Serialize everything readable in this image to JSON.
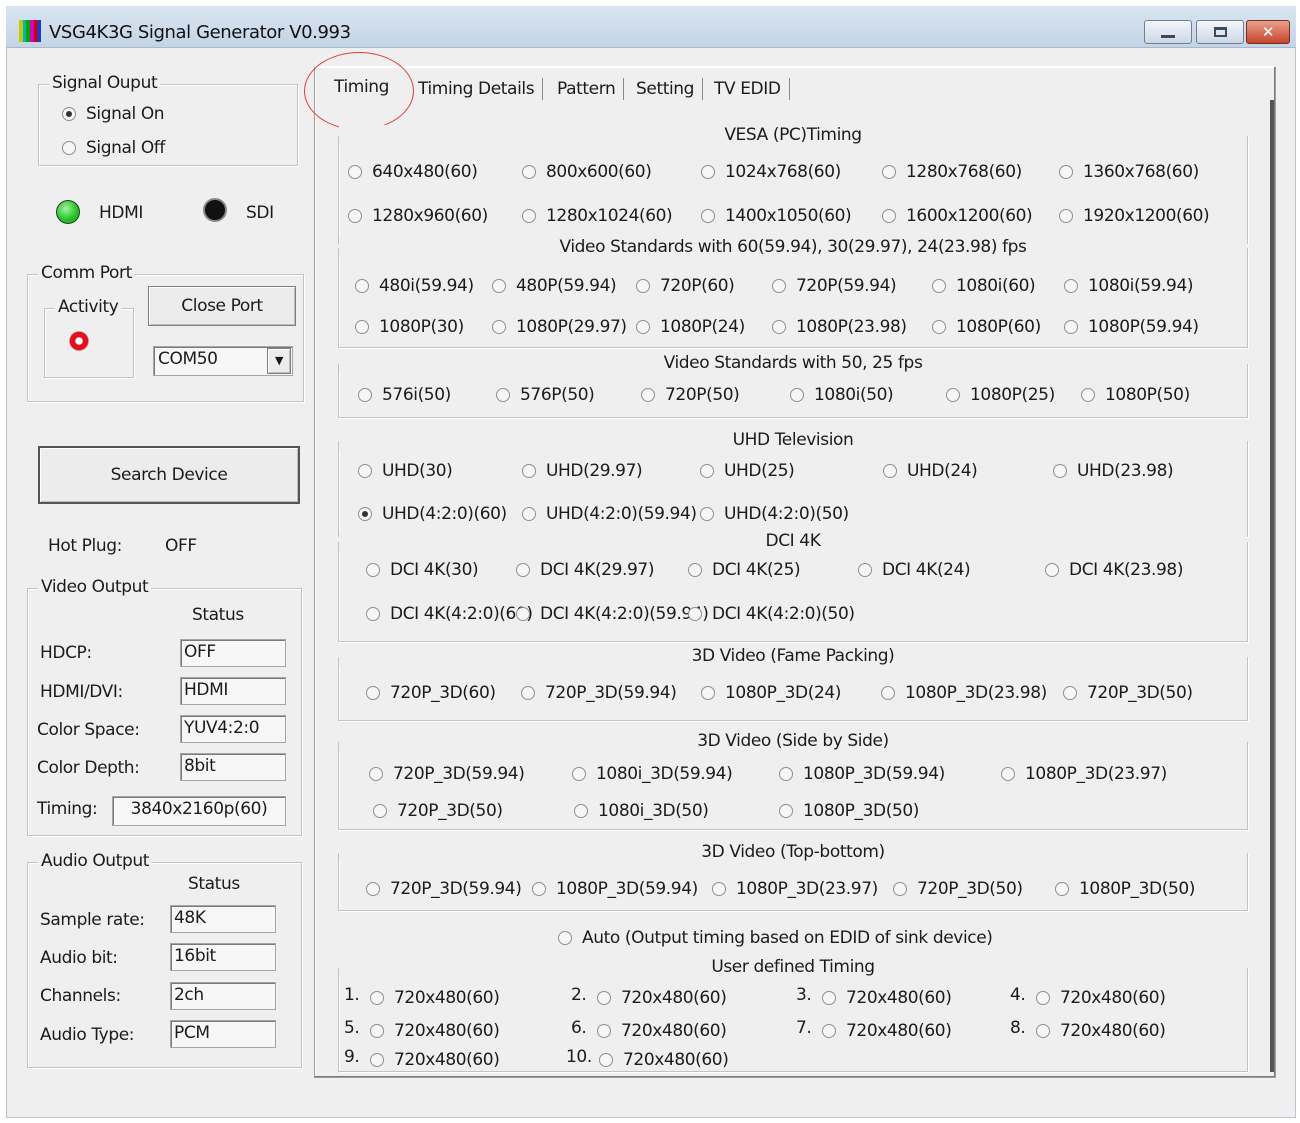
{
  "window": {
    "title": "VSG4K3G Signal Generator V0.993",
    "icon_colors": [
      "#c9c900",
      "#00b4c8",
      "#00a800",
      "#d400c8",
      "#d40000",
      "#1f38c8"
    ]
  },
  "left": {
    "signal_output": {
      "legend": "Signal Ouput",
      "on_label": "Signal On",
      "off_label": "Signal Off",
      "selected": "on"
    },
    "outputs": {
      "hdmi_label": "HDMI",
      "sdi_label": "SDI",
      "hdmi_color": "#1fbf1f",
      "sdi_color": "#111111"
    },
    "comm_port": {
      "legend": "Comm Port",
      "activity_legend": "Activity",
      "close_label": "Close Port",
      "port_value": "COM50",
      "activity_color": "#e0101e"
    },
    "search_label": "Search Device",
    "hot_plug": {
      "label": "Hot Plug:",
      "value": "OFF"
    },
    "video_output": {
      "legend": "Video Output",
      "status_header": "Status",
      "hdcp_label": "HDCP:",
      "hdcp_value": "OFF",
      "hdmidvi_label": "HDMI/DVI:",
      "hdmidvi_value": "HDMI",
      "colorspace_label": "Color Space:",
      "colorspace_value": "YUV4:2:0",
      "colordepth_label": "Color Depth:",
      "colordepth_value": "8bit",
      "timing_label": "Timing:",
      "timing_value": "3840x2160p(60)"
    },
    "audio_output": {
      "legend": "Audio Output",
      "status_header": "Status",
      "samplerate_label": "Sample rate:",
      "samplerate_value": "48K",
      "audiobit_label": "Audio bit:",
      "audiobit_value": "16bit",
      "channels_label": "Channels:",
      "channels_value": "2ch",
      "audiotype_label": "Audio Type:",
      "audiotype_value": "PCM"
    }
  },
  "tabs": [
    "Timing",
    "Timing Details",
    "Pattern",
    "Setting",
    "TV EDID"
  ],
  "active_tab": "Timing",
  "highlight_color": "#e0403f",
  "sections": {
    "vesa": {
      "title": "VESA  (PC)Timing",
      "options": [
        "640x480(60)",
        "800x600(60)",
        "1024x768(60)",
        "1280x768(60)",
        "1360x768(60)",
        "1280x960(60)",
        "1280x1024(60)",
        "1400x1050(60)",
        "1600x1200(60)",
        "1920x1200(60)"
      ]
    },
    "video60": {
      "title": "Video Standards with 60(59.94), 30(29.97), 24(23.98) fps",
      "options": [
        "480i(59.94)",
        "480P(59.94)",
        "720P(60)",
        "720P(59.94)",
        "1080i(60)",
        "1080i(59.94)",
        "1080P(30)",
        "1080P(29.97)",
        "1080P(24)",
        "1080P(23.98)",
        "1080P(60)",
        "1080P(59.94)"
      ]
    },
    "video50": {
      "title": "Video Standards with 50, 25 fps",
      "options": [
        "576i(50)",
        "576P(50)",
        "720P(50)",
        "1080i(50)",
        "1080P(25)",
        "1080P(50)"
      ]
    },
    "uhd": {
      "title": "UHD Television",
      "options": [
        "UHD(30)",
        "UHD(29.97)",
        "UHD(25)",
        "UHD(24)",
        "UHD(23.98)",
        "UHD(4:2:0)(60)",
        "UHD(4:2:0)(59.94)",
        "UHD(4:2:0)(50)"
      ]
    },
    "dci": {
      "title": "DCI 4K",
      "options": [
        "DCI 4K(30)",
        "DCI 4K(29.97)",
        "DCI 4K(25)",
        "DCI 4K(24)",
        "DCI 4K(23.98)",
        "DCI 4K(4:2:0)(60)",
        "DCI 4K(4:2:0)(59.94)",
        "DCI 4K(4:2:0)(50)"
      ]
    },
    "fp3d": {
      "title": "3D Video (Fame Packing)",
      "options": [
        "720P_3D(60)",
        "720P_3D(59.94)",
        "1080P_3D(24)",
        "1080P_3D(23.98)",
        "720P_3D(50)"
      ]
    },
    "sbs3d": {
      "title": "3D Video (Side by Side)",
      "options": [
        "720P_3D(59.94)",
        "1080i_3D(59.94)",
        "1080P_3D(59.94)",
        "1080P_3D(23.97)",
        "720P_3D(50)",
        "1080i_3D(50)",
        "1080P_3D(50)"
      ]
    },
    "tb3d": {
      "title": "3D Video (Top-bottom)",
      "options": [
        "720P_3D(59.94)",
        "1080P_3D(59.94)",
        "1080P_3D(23.97)",
        "720P_3D(50)",
        "1080P_3D(50)"
      ]
    },
    "auto_label": "Auto (Output timing based on EDID of sink device)",
    "user": {
      "title": "User defined Timing",
      "items": [
        {
          "num": "1.",
          "label": "720x480(60)"
        },
        {
          "num": "2.",
          "label": "720x480(60)"
        },
        {
          "num": "3.",
          "label": "720x480(60)"
        },
        {
          "num": "4.",
          "label": "720x480(60)"
        },
        {
          "num": "5.",
          "label": "720x480(60)"
        },
        {
          "num": "6.",
          "label": "720x480(60)"
        },
        {
          "num": "7.",
          "label": "720x480(60)"
        },
        {
          "num": "8.",
          "label": "720x480(60)"
        },
        {
          "num": "9.",
          "label": "720x480(60)"
        },
        {
          "num": "10.",
          "label": "720x480(60)"
        }
      ]
    }
  },
  "selected_timing": "UHD(4:2:0)(60)"
}
